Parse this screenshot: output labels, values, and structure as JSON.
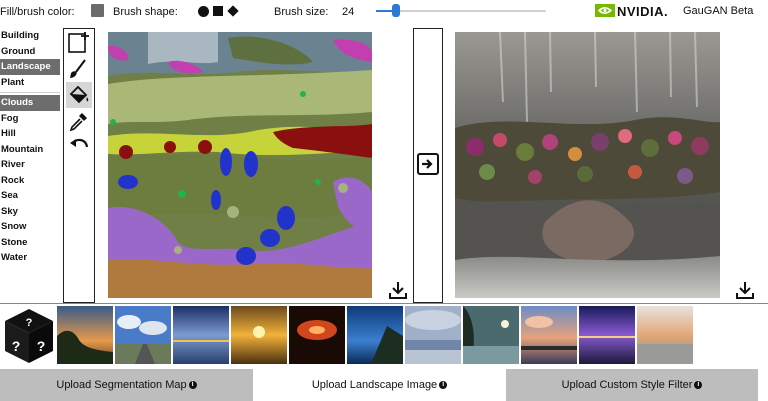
{
  "toolbar": {
    "fill_label": "Fill/brush color:",
    "fill_color": "#6b6b6b",
    "shape_label": "Brush shape:",
    "shapes": [
      "circle",
      "square",
      "diamond"
    ],
    "size_label": "Brush size:",
    "size_value": "24",
    "slider_fraction": 0.12
  },
  "brand": {
    "logo_icon": "nvidia-eye-icon",
    "logo_text": "NVIDIA.",
    "app_name": "GauGAN Beta"
  },
  "labels": {
    "group1": [
      "Building",
      "Ground",
      "Landscape",
      "Plant"
    ],
    "group2": [
      "Clouds",
      "Fog",
      "Hill",
      "Mountain",
      "River",
      "Rock",
      "Sea",
      "Sky",
      "Snow",
      "Stone",
      "Water"
    ],
    "selected_landscape": "Landscape",
    "selected_clouds": "Clouds"
  },
  "tools": [
    "new-canvas-icon",
    "brush-icon",
    "paint-bucket-icon",
    "eyedropper-icon",
    "undo-icon"
  ],
  "colors": {
    "accent": "#2a7ad6",
    "nvidia_green": "#76b900",
    "selected_bg": "#6d6d6d",
    "upload_shaded": "#bdbdbd"
  },
  "bottom": {
    "upload_segmentation": "Upload Segmentation Map",
    "upload_landscape": "Upload Landscape Image",
    "upload_style": "Upload Custom Style Filter",
    "info_glyph": "i"
  }
}
